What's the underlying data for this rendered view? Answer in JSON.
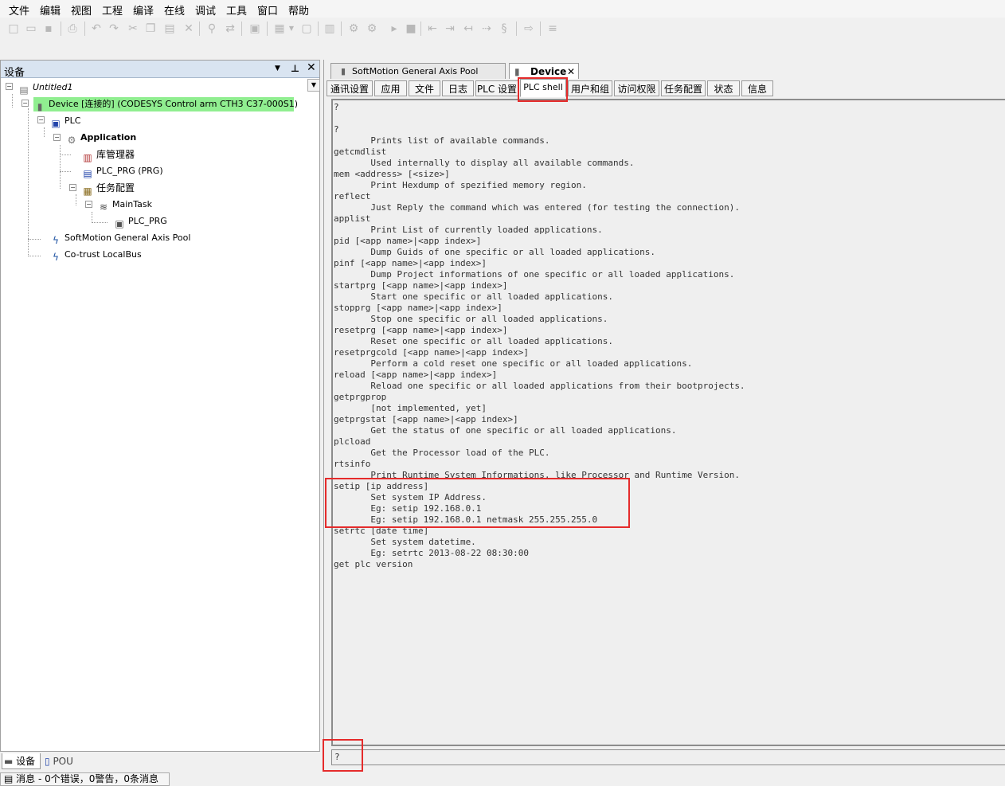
{
  "menu": [
    "文件",
    "编辑",
    "视图",
    "工程",
    "编译",
    "在线",
    "调试",
    "工具",
    "窗口",
    "帮助"
  ],
  "devices_panel": {
    "title": "设备",
    "tree": {
      "project": "Untitled1",
      "device": "Device [连接的] (CODESYS Control arm CTH3 C37-000S1)",
      "plc": "PLC",
      "application": "Application",
      "library_manager": "库管理器",
      "plc_prg": "PLC_PRG (PRG)",
      "task_config": "任务配置",
      "main_task": "MainTask",
      "main_task_plc_prg": "PLC_PRG",
      "softmotion": "SoftMotion General Axis Pool",
      "localbus": "Co-trust LocalBus"
    },
    "bottom_tabs": [
      "设备",
      "POU"
    ]
  },
  "status_bar": "消息 - 0个错误，0警告，0条消息",
  "editor": {
    "doc_tabs": [
      "SoftMotion General Axis Pool",
      "Device"
    ],
    "sub_tabs": [
      "通讯设置",
      "应用",
      "文件",
      "日志",
      "PLC 设置",
      "PLC shell",
      "用户和组",
      "访问权限",
      "任务配置",
      "状态",
      "信息"
    ],
    "active_sub_tab": "PLC shell",
    "shell_output": "?\n\n?\n       Prints list of available commands.\ngetcmdlist\n       Used internally to display all available commands.\nmem <address> [<size>]\n       Print Hexdump of spezified memory region.\nreflect\n       Just Reply the command which was entered (for testing the connection).\napplist\n       Print List of currently loaded applications.\npid [<app name>|<app index>]\n       Dump Guids of one specific or all loaded applications.\npinf [<app name>|<app index>]\n       Dump Project informations of one specific or all loaded applications.\nstartprg [<app name>|<app index>]\n       Start one specific or all loaded applications.\nstopprg [<app name>|<app index>]\n       Stop one specific or all loaded applications.\nresetprg [<app name>|<app index>]\n       Reset one specific or all loaded applications.\nresetprgcold [<app name>|<app index>]\n       Perform a cold reset one specific or all loaded applications.\nreload [<app name>|<app index>]\n       Reload one specific or all loaded applications from their bootprojects.\ngetprgprop\n       [not implemented, yet]\ngetprgstat [<app name>|<app index>]\n       Get the status of one specific or all loaded applications.\nplcload\n       Get the Processor load of the PLC.\nrtsinfo\n       Print Runtime System Informations, like Processor and Runtime Version.\nsetip [ip address]\n       Set system IP Address.\n       Eg: setip 192.168.0.1\n       Eg: setip 192.168.0.1 netmask 255.255.255.0\nsetrtc [date time]\n       Set system datetime.\n       Eg: setrtc 2013-08-22 08:30:00\nget plc version",
    "shell_input": "?"
  },
  "colors": {
    "highlight_red": "#e52b2b",
    "connected_green": "#90ee90",
    "panel_header": "#d9e4f1"
  }
}
